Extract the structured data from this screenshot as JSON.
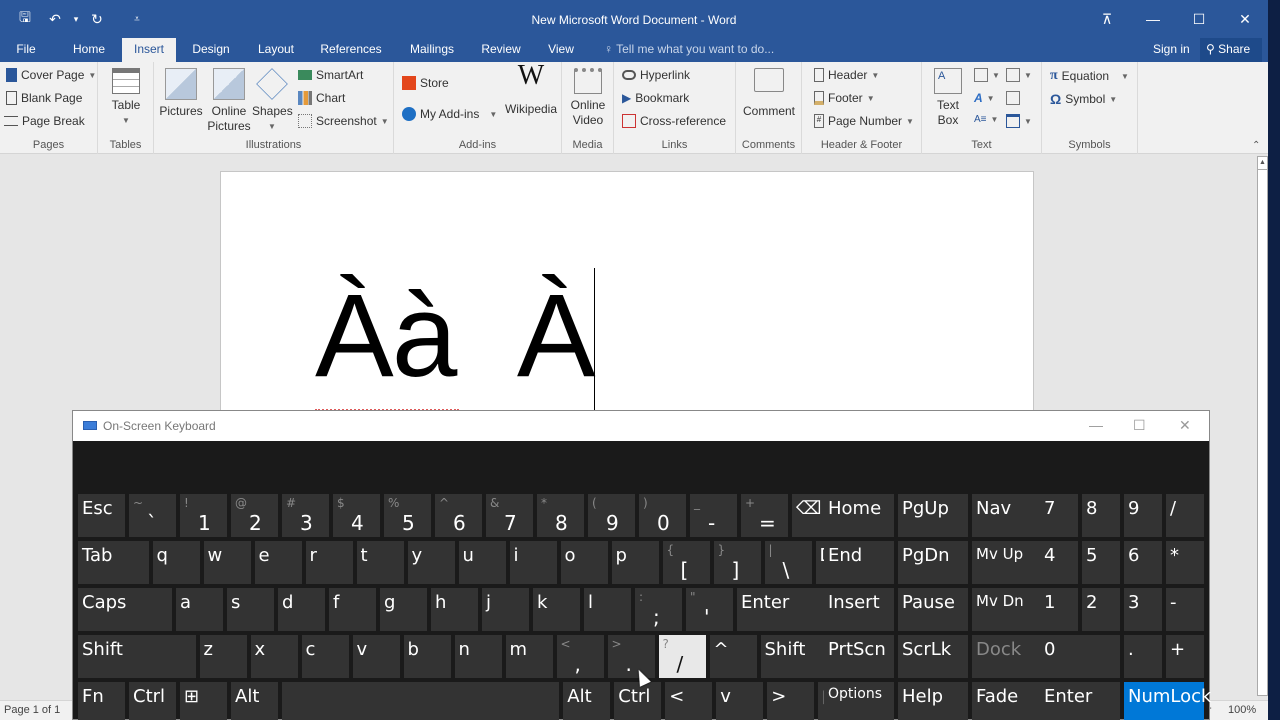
{
  "window": {
    "title": "New Microsoft Word Document - Word",
    "qat": [
      {
        "name": "save-icon",
        "glyph": "🖫"
      },
      {
        "name": "undo-icon",
        "glyph": "↶"
      },
      {
        "name": "undo-dropdown-icon",
        "glyph": "▾"
      },
      {
        "name": "redo-icon",
        "glyph": "↻"
      },
      {
        "name": "customize-qat-icon",
        "glyph": "⩡"
      }
    ],
    "controls": {
      "restore_ribbon": "⊼",
      "minimize": "—",
      "maximize": "☐",
      "close": "✕"
    }
  },
  "tabs": {
    "items": [
      "File",
      "Home",
      "Insert",
      "Design",
      "Layout",
      "References",
      "Mailings",
      "Review",
      "View"
    ],
    "active": "Insert",
    "tell_me": "Tell me what you want to do...",
    "sign_in": "Sign in",
    "share": "Share"
  },
  "ribbon": {
    "groups": {
      "pages": {
        "label": "Pages",
        "items": [
          "Cover Page",
          "Blank Page",
          "Page Break"
        ]
      },
      "tables": {
        "label": "Tables",
        "items": [
          "Table"
        ]
      },
      "illustrations": {
        "label": "Illustrations",
        "large": [
          "Pictures",
          "Online Pictures",
          "Shapes"
        ],
        "small": [
          "SmartArt",
          "Chart",
          "Screenshot"
        ]
      },
      "addins": {
        "label": "Add-ins",
        "small": [
          "Store",
          "My Add-ins"
        ],
        "large": [
          "Wikipedia"
        ]
      },
      "media": {
        "label": "Media",
        "large": [
          "Online Video"
        ]
      },
      "links": {
        "label": "Links",
        "small": [
          "Hyperlink",
          "Bookmark",
          "Cross-reference"
        ]
      },
      "comments": {
        "label": "Comments",
        "large": [
          "Comment"
        ]
      },
      "header_footer": {
        "label": "Header & Footer",
        "small": [
          "Header",
          "Footer",
          "Page Number"
        ]
      },
      "text": {
        "label": "Text",
        "large": [
          "Text Box"
        ]
      },
      "symbols": {
        "label": "Symbols",
        "small": [
          "Equation",
          "Symbol"
        ]
      }
    }
  },
  "document": {
    "text": "Àà  À"
  },
  "status": {
    "page": "Page 1 of 1",
    "zoom": "100%"
  },
  "osk": {
    "title": "On-Screen Keyboard",
    "rows": [
      [
        {
          "label": "Esc",
          "w": 1
        },
        {
          "shift": "~",
          "low": "`"
        },
        {
          "shift": "!",
          "low": "1"
        },
        {
          "shift": "@",
          "low": "2"
        },
        {
          "shift": "#",
          "low": "3"
        },
        {
          "shift": "$",
          "low": "4"
        },
        {
          "shift": "%",
          "low": "5"
        },
        {
          "shift": "^",
          "low": "6"
        },
        {
          "shift": "&",
          "low": "7"
        },
        {
          "shift": "*",
          "low": "8"
        },
        {
          "shift": "(",
          "low": "9"
        },
        {
          "shift": ")",
          "low": "0"
        },
        {
          "shift": "_",
          "low": "-"
        },
        {
          "shift": "+",
          "low": "="
        },
        {
          "label": "⌫",
          "w": 1.6
        }
      ],
      [
        {
          "label": "Tab",
          "w": 1.5
        },
        {
          "label": "q"
        },
        {
          "label": "w"
        },
        {
          "label": "e"
        },
        {
          "label": "r"
        },
        {
          "label": "t"
        },
        {
          "label": "y"
        },
        {
          "label": "u"
        },
        {
          "label": "i"
        },
        {
          "label": "o"
        },
        {
          "label": "p"
        },
        {
          "shift": "{",
          "low": "["
        },
        {
          "shift": "}",
          "low": "]"
        },
        {
          "shift": "|",
          "low": "\\"
        },
        {
          "label": "Del",
          "w": 1.1
        }
      ],
      [
        {
          "label": "Caps",
          "w": 2
        },
        {
          "label": "a"
        },
        {
          "label": "s"
        },
        {
          "label": "d"
        },
        {
          "label": "f"
        },
        {
          "label": "g"
        },
        {
          "label": "h"
        },
        {
          "label": "j"
        },
        {
          "label": "k"
        },
        {
          "label": "l"
        },
        {
          "shift": ":",
          "low": ";"
        },
        {
          "shift": "\"",
          "low": "'"
        },
        {
          "label": "Enter",
          "w": 2.6
        }
      ],
      [
        {
          "label": "Shift",
          "w": 2.5
        },
        {
          "label": "z"
        },
        {
          "label": "x"
        },
        {
          "label": "c"
        },
        {
          "label": "v"
        },
        {
          "label": "b"
        },
        {
          "label": "n"
        },
        {
          "label": "m"
        },
        {
          "shift": "<",
          "low": ","
        },
        {
          "shift": ">",
          "low": "."
        },
        {
          "shift": "?",
          "low": "/",
          "active": true
        },
        {
          "label": "^",
          "w": 1
        },
        {
          "label": "Shift",
          "w": 2.1
        }
      ],
      [
        {
          "label": "Fn"
        },
        {
          "label": "Ctrl"
        },
        {
          "label": "⊞"
        },
        {
          "label": "Alt"
        },
        {
          "label": "",
          "w": 5.9
        },
        {
          "label": "Alt"
        },
        {
          "label": "Ctrl"
        },
        {
          "label": "<"
        },
        {
          "label": "v"
        },
        {
          "label": ">"
        },
        {
          "label": "▤"
        }
      ]
    ],
    "nav": [
      [
        "Home",
        "PgUp",
        "Nav"
      ],
      [
        "End",
        "PgDn",
        "Mv Up"
      ],
      [
        "Insert",
        "Pause",
        "Mv Dn"
      ],
      [
        "PrtScn",
        "ScrLk",
        "Dock"
      ],
      [
        "Options",
        "Help",
        "Fade"
      ]
    ],
    "numpad": [
      [
        "7",
        "8",
        "9",
        "/"
      ],
      [
        "4",
        "5",
        "6",
        "*"
      ],
      [
        "1",
        "2",
        "3",
        "-"
      ],
      [
        "0",
        ".",
        "+"
      ],
      [
        "Enter",
        "NumLock"
      ]
    ],
    "dimmed": [
      "Dock"
    ],
    "highlighted": [
      "NumLock"
    ],
    "controls": {
      "minimize": "—",
      "maximize": "☐",
      "close": "✕"
    }
  }
}
